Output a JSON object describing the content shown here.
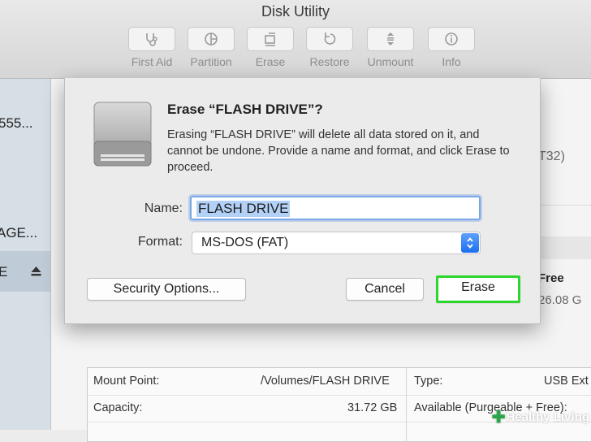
{
  "window": {
    "title": "Disk Utility"
  },
  "toolbar": {
    "items": [
      {
        "label": "First Aid",
        "icon": "stethoscope-icon"
      },
      {
        "label": "Partition",
        "icon": "pie-icon"
      },
      {
        "label": "Erase",
        "icon": "eraser-icon"
      },
      {
        "label": "Restore",
        "icon": "restore-arrow-icon"
      },
      {
        "label": "Unmount",
        "icon": "unmount-icon"
      },
      {
        "label": "Info",
        "icon": "info-icon"
      }
    ]
  },
  "sidebar": {
    "items": [
      {
        "label": "555..."
      },
      {
        "label": "AGE..."
      },
      {
        "label": "E",
        "selected": true
      }
    ]
  },
  "background": {
    "format_fragment": "T32)",
    "free_label": "Free",
    "free_value": "26.08 G"
  },
  "info_panel": {
    "mount_point_label": "Mount Point:",
    "mount_point_value": "/Volumes/FLASH DRIVE",
    "capacity_label": "Capacity:",
    "capacity_value": "31.72 GB",
    "type_label": "Type:",
    "type_value": "USB Ext",
    "available_label": "Available (Purgeable + Free):"
  },
  "dialog": {
    "title": "Erase “FLASH DRIVE”?",
    "body": "Erasing “FLASH DRIVE” will delete all data stored on it, and cannot be undone. Provide a name and format, and click Erase to proceed.",
    "name_label": "Name:",
    "name_value": "FLASH DRIVE",
    "format_label": "Format:",
    "format_value": "MS-DOS (FAT)",
    "security_button": "Security Options...",
    "cancel_button": "Cancel",
    "erase_button": "Erase"
  },
  "colors": {
    "accent": "#1d6ff0",
    "highlight": "#2dd62d",
    "selection": "#b3d1f6"
  },
  "watermark": {
    "text": "Healthy Living"
  }
}
